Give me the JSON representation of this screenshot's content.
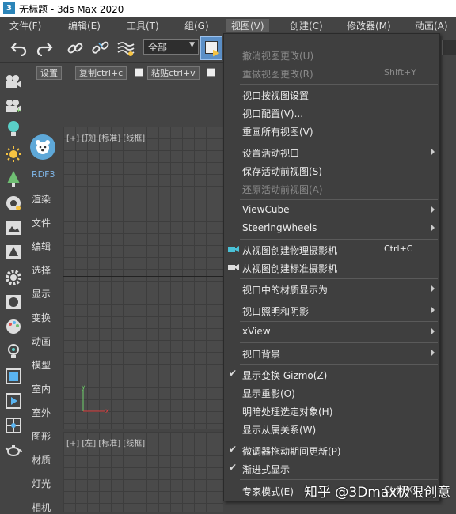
{
  "window": {
    "title": "无标题 - 3ds Max 2020",
    "icon_text": "3"
  },
  "menubar": {
    "items": [
      "文件(F)",
      "编辑(E)",
      "工具(T)",
      "组(G)",
      "视图(V)",
      "创建(C)",
      "修改器(M)",
      "动画(A)"
    ]
  },
  "toolbar": {
    "selection_filter": "全部"
  },
  "toolbar2": {
    "settings": "设置",
    "copy": "复制ctrl+c",
    "paste": "粘贴ctrl+v"
  },
  "left_panel": {
    "avatar_label": "RDF3",
    "categories": [
      "渲染",
      "文件",
      "编辑",
      "选择",
      "显示",
      "变换",
      "动画",
      "模型",
      "室内",
      "室外",
      "图形",
      "材质",
      "灯光",
      "相机"
    ]
  },
  "viewports": {
    "top_label": "[+] [顶] [标准] [线框]",
    "left_label": "[+] [左] [标准] [线框]",
    "gizmo_y": "y",
    "gizmo_x": "x"
  },
  "view_menu": {
    "groups": [
      [
        {
          "label": "撤消视图更改(U)",
          "enabled": false
        },
        {
          "label": "重做视图更改(R)",
          "shortcut": "Shift+Y",
          "enabled": false
        }
      ],
      [
        {
          "label": "视口按视图设置"
        },
        {
          "label": "视口配置(V)..."
        },
        {
          "label": "重画所有视图(V)"
        }
      ],
      [
        {
          "label": "设置活动视口",
          "submenu": true
        },
        {
          "label": "保存活动前视图(S)"
        },
        {
          "label": "还原活动前视图(A)",
          "enabled": false
        }
      ],
      [
        {
          "label": "ViewCube",
          "submenu": true
        },
        {
          "label": "SteeringWheels",
          "submenu": true
        }
      ],
      [
        {
          "label": "从视图创建物理摄影机",
          "shortcut": "Ctrl+C",
          "icon": "camera-physical-icon"
        },
        {
          "label": "从视图创建标准摄影机",
          "icon": "camera-standard-icon"
        }
      ],
      [
        {
          "label": "视口中的材质显示为",
          "submenu": true
        }
      ],
      [
        {
          "label": "视口照明和阴影",
          "submenu": true
        }
      ],
      [
        {
          "label": "xView",
          "submenu": true
        }
      ],
      [
        {
          "label": "视口背景",
          "submenu": true
        }
      ],
      [
        {
          "label": "显示变换 Gizmo(Z)",
          "checked": true
        },
        {
          "label": "显示重影(O)"
        },
        {
          "label": "明暗处理选定对象(H)"
        },
        {
          "label": "显示从属关系(W)"
        }
      ],
      [
        {
          "label": "微调器拖动期间更新(P)",
          "checked": true
        },
        {
          "label": "渐进式显示",
          "checked": true
        }
      ],
      [
        {
          "label": "专家模式(E)",
          "shortcut": "Ctrl+X"
        }
      ]
    ]
  },
  "watermark": "知乎 @3Dmax极限创意",
  "colors": {
    "menu_bg": "#3f3f3f",
    "ui_bg": "#444444",
    "viewport_bg": "#4a4a4a",
    "accent": "#5b8fc7"
  }
}
